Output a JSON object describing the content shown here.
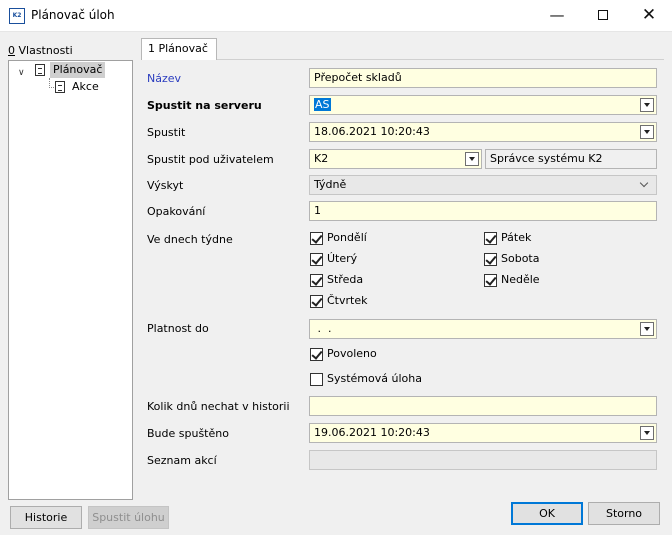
{
  "window": {
    "title": "Plánovač úloh",
    "app_badge": "K2",
    "minimize": "—",
    "close": "✕"
  },
  "left_panel": {
    "header_hotkey": "0",
    "header_label": " Vlastnosti",
    "tree": [
      {
        "label": "Plánovač",
        "expanded": true,
        "selected": true
      },
      {
        "label": "Akce"
      }
    ]
  },
  "tab": {
    "label": "1 Plánovač"
  },
  "form": {
    "nazev": {
      "label": "Název",
      "value": "Přepočet skladů"
    },
    "server": {
      "label": "Spustit na serveru",
      "value": "AS"
    },
    "spustit": {
      "label": "Spustit",
      "value": "18.06.2021 10:20:43"
    },
    "uzivatel": {
      "label": "Spustit pod uživatelem",
      "value": "K2",
      "name": "Správce systému K2"
    },
    "vyskyt": {
      "label": "Výskyt",
      "value": "Týdně"
    },
    "opakovani": {
      "label": "Opakování",
      "value": "1"
    },
    "dny": {
      "label": "Ve dnech týdne",
      "days": [
        {
          "label": "Pondělí",
          "checked": true
        },
        {
          "label": "Úterý",
          "checked": true
        },
        {
          "label": "Středa",
          "checked": true
        },
        {
          "label": "Čtvrtek",
          "checked": true
        },
        {
          "label": "Pátek",
          "checked": true
        },
        {
          "label": "Sobota",
          "checked": true
        },
        {
          "label": "Neděle",
          "checked": true
        }
      ]
    },
    "platnost": {
      "label": "Platnost do",
      "value": " .  ."
    },
    "povoleno": {
      "label": "Povoleno",
      "checked": true
    },
    "systemova": {
      "label": "Systémová úloha",
      "checked": false
    },
    "historie": {
      "label": "Kolik dnů nechat v historii",
      "value": ""
    },
    "bude": {
      "label": "Bude spuštěno",
      "value": "19.06.2021 10:20:43"
    },
    "seznam": {
      "label": "Seznam akcí",
      "value": ""
    }
  },
  "buttons": {
    "historie": "Historie",
    "spustit_ulohu": "Spustit úlohu",
    "ok": "OK",
    "storno": "Storno"
  },
  "colors": {
    "field_bg": "#ffffe1",
    "accent": "#0078d7",
    "label_blue": "#2a3cbf"
  }
}
